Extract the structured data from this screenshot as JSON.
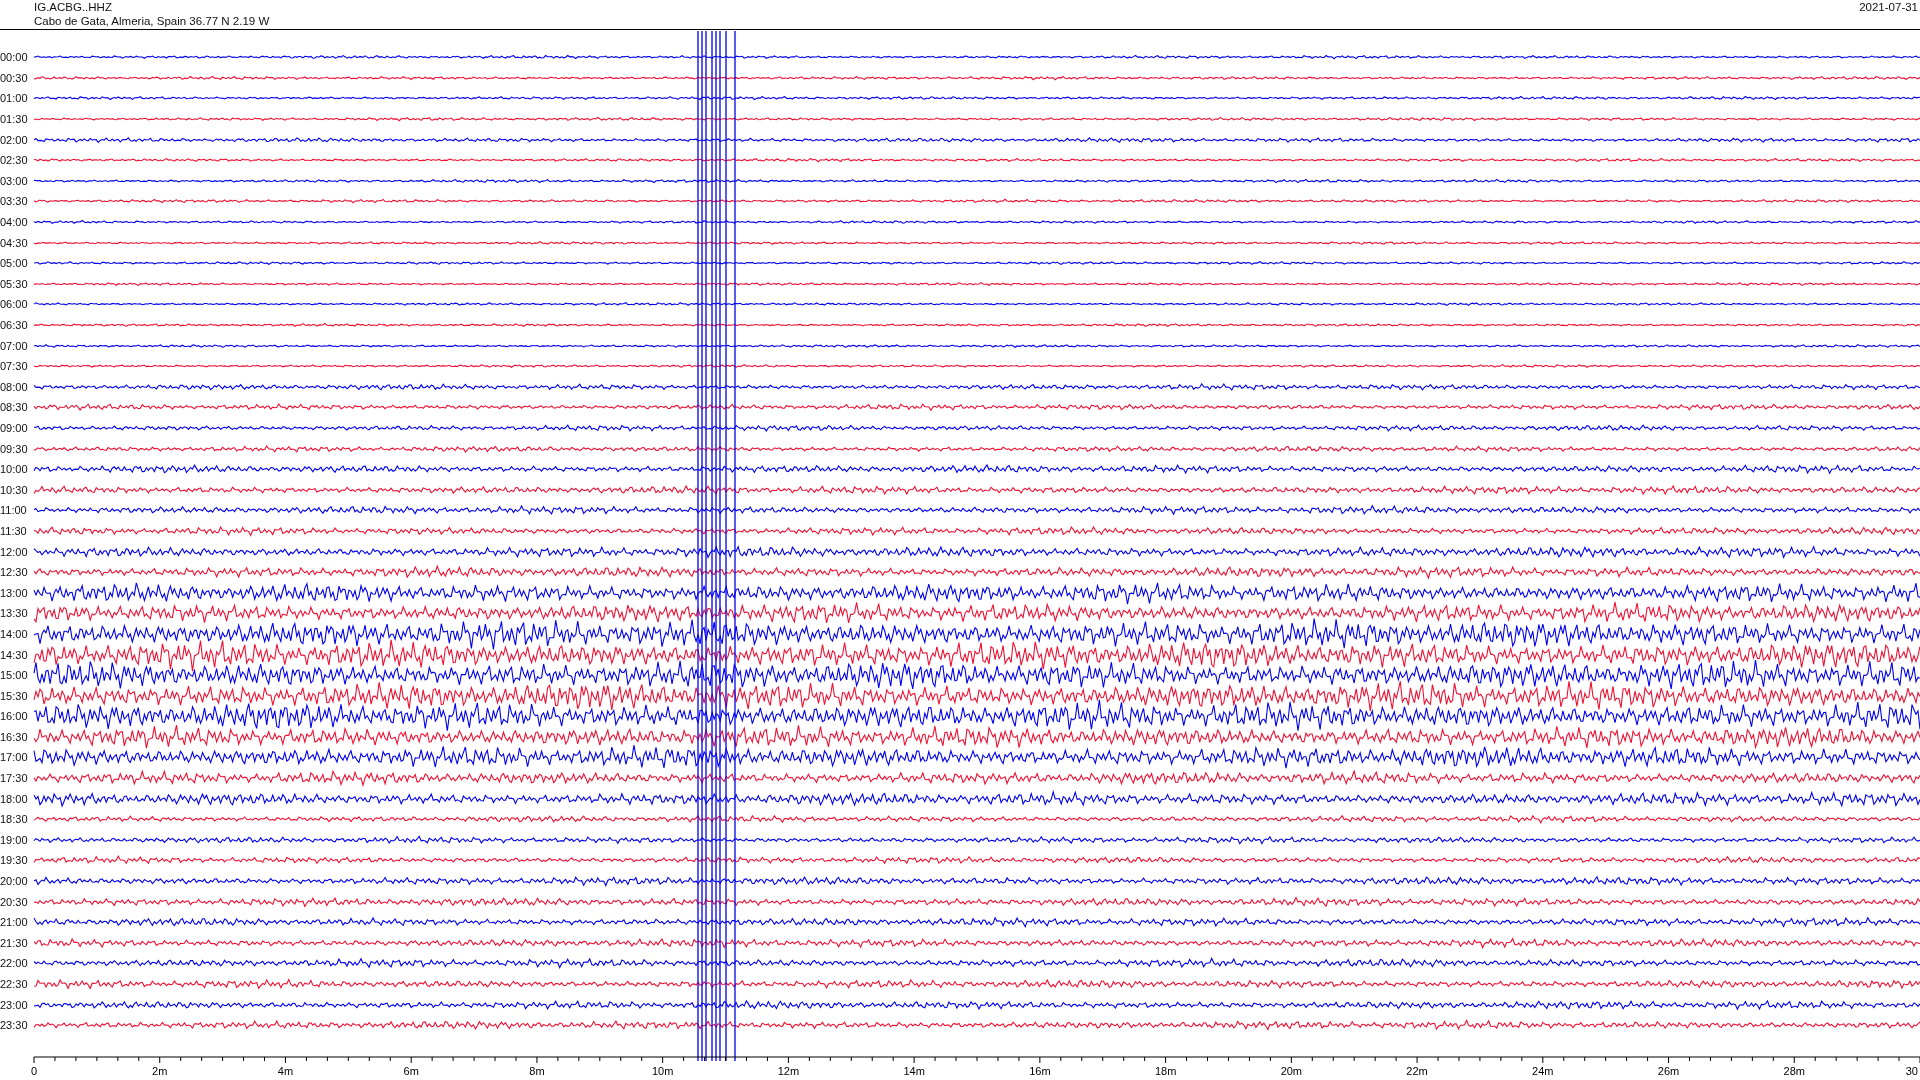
{
  "header": {
    "station": "IG.ACBG..HHZ",
    "location": "Cabo de Gata, Almeria, Spain  36.77 N 2.19 W",
    "date": "2021-07-31"
  },
  "rows": [
    {
      "label": "00:00",
      "color": "#0000ee"
    },
    {
      "label": "00:30",
      "color": "#ee1133"
    },
    {
      "label": "01:00",
      "color": "#0000ee"
    },
    {
      "label": "01:30",
      "color": "#ee1133"
    },
    {
      "label": "02:00",
      "color": "#0000ee"
    },
    {
      "label": "02:30",
      "color": "#ee1133"
    },
    {
      "label": "03:00",
      "color": "#0000ee"
    },
    {
      "label": "03:30",
      "color": "#ee1133"
    },
    {
      "label": "04:00",
      "color": "#0000ee"
    },
    {
      "label": "04:30",
      "color": "#ee1133"
    },
    {
      "label": "05:00",
      "color": "#0000ee"
    },
    {
      "label": "05:30",
      "color": "#ee1133"
    },
    {
      "label": "06:00",
      "color": "#0000ee"
    },
    {
      "label": "06:30",
      "color": "#ee1133"
    },
    {
      "label": "07:00",
      "color": "#0000ee"
    },
    {
      "label": "07:30",
      "color": "#ee1133"
    },
    {
      "label": "08:00",
      "color": "#0000ee"
    },
    {
      "label": "08:30",
      "color": "#ee1133"
    },
    {
      "label": "09:00",
      "color": "#0000ee"
    },
    {
      "label": "09:30",
      "color": "#ee1133"
    },
    {
      "label": "10:00",
      "color": "#0000ee"
    },
    {
      "label": "10:30",
      "color": "#ee1133"
    },
    {
      "label": "11:00",
      "color": "#0000ee"
    },
    {
      "label": "11:30",
      "color": "#ee1133"
    },
    {
      "label": "12:00",
      "color": "#0000ee"
    },
    {
      "label": "12:30",
      "color": "#ee1133"
    },
    {
      "label": "13:00",
      "color": "#0000ee"
    },
    {
      "label": "13:30",
      "color": "#ee1133"
    },
    {
      "label": "14:00",
      "color": "#0000ee"
    },
    {
      "label": "14:30",
      "color": "#ee1133"
    },
    {
      "label": "15:00",
      "color": "#0000ee"
    },
    {
      "label": "15:30",
      "color": "#ee1133"
    },
    {
      "label": "16:00",
      "color": "#0000ee"
    },
    {
      "label": "16:30",
      "color": "#ee1133"
    },
    {
      "label": "17:00",
      "color": "#0000ee"
    },
    {
      "label": "17:30",
      "color": "#ee1133"
    },
    {
      "label": "18:00",
      "color": "#0000ee"
    },
    {
      "label": "18:30",
      "color": "#ee1133"
    },
    {
      "label": "19:00",
      "color": "#0000ee"
    },
    {
      "label": "19:30",
      "color": "#ee1133"
    },
    {
      "label": "20:00",
      "color": "#0000ee"
    },
    {
      "label": "20:30",
      "color": "#ee1133"
    },
    {
      "label": "21:00",
      "color": "#0000ee"
    },
    {
      "label": "21:30",
      "color": "#ee1133"
    },
    {
      "label": "22:00",
      "color": "#0000ee"
    },
    {
      "label": "22:30",
      "color": "#ee1133"
    },
    {
      "label": "23:00",
      "color": "#0000ee"
    },
    {
      "label": "23:30",
      "color": "#ee1133"
    }
  ],
  "x_axis": {
    "ticks": [
      "0",
      "2m",
      "4m",
      "6m",
      "8m",
      "10m",
      "12m",
      "14m",
      "16m",
      "18m",
      "20m",
      "22m",
      "24m",
      "26m",
      "28m",
      "30"
    ]
  }
}
